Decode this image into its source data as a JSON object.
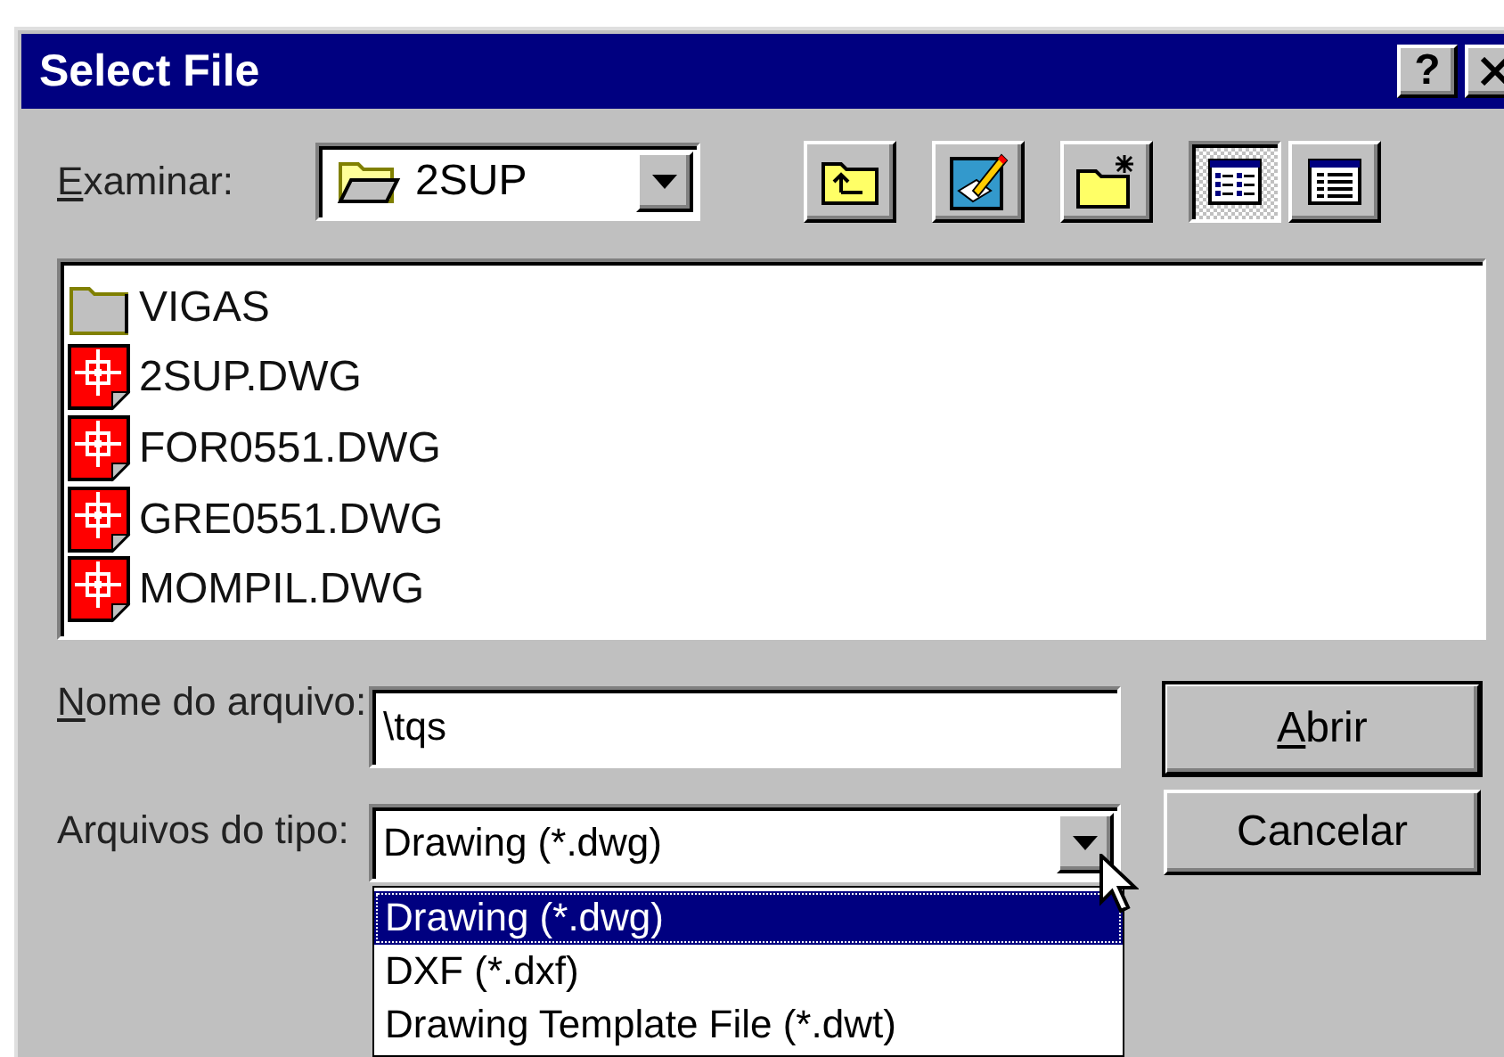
{
  "window": {
    "title": "Select File",
    "help_button": "?"
  },
  "look_in": {
    "label": "Examinar:",
    "value": "2SUP"
  },
  "toolbar": {
    "actions": [
      {
        "kind": "up_folder"
      },
      {
        "kind": "desktop"
      },
      {
        "kind": "new_folder"
      }
    ],
    "views": [
      {
        "kind": "list",
        "selected": true
      },
      {
        "kind": "details",
        "selected": false
      }
    ]
  },
  "files": [
    {
      "name": "VIGAS",
      "kind": "folder"
    },
    {
      "name": "2SUP.DWG",
      "kind": "drawing"
    },
    {
      "name": "FOR0551.DWG",
      "kind": "drawing"
    },
    {
      "name": "GRE0551.DWG",
      "kind": "drawing"
    },
    {
      "name": "MOMPIL.DWG",
      "kind": "drawing"
    }
  ],
  "file_name": {
    "label": "Nome do arquivo:",
    "value": "\\tqs"
  },
  "file_type": {
    "label": "Arquivos do tipo:",
    "value": "Drawing (*.dwg)",
    "expanded": true,
    "options": [
      {
        "label": "Drawing (*.dwg)",
        "selected": true
      },
      {
        "label": "DXF (*.dxf)",
        "selected": false
      },
      {
        "label": "Drawing Template File (*.dwt)",
        "selected": false
      }
    ]
  },
  "buttons": [
    {
      "label": "Abrir",
      "default": true
    },
    {
      "label": "Cancelar",
      "default": false
    }
  ]
}
